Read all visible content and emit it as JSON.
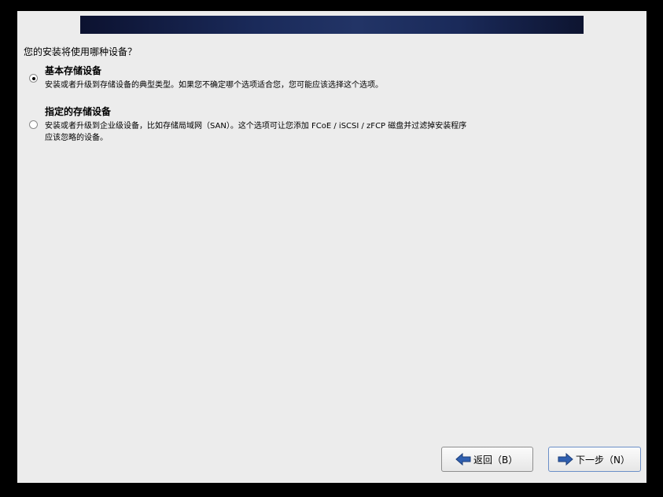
{
  "installer": {
    "question": "您的安装将使用哪种设备？",
    "options": [
      {
        "title": "基本存储设备",
        "desc_lines": [
          "安装或者升级到存储设备的典型类型。如果您不确定哪个选项适合您，您可能应该选择这个选项。"
        ],
        "selected": true
      },
      {
        "title": "指定的存储设备",
        "desc_lines": [
          "安装或者升级到企业级设备，比如存储局域网（SAN）。这个选项可让您添加 FCoE / iSCSI / zFCP 磁盘并过滤掉安装程序",
          "应该忽略的设备。"
        ],
        "selected": false
      }
    ],
    "buttons": {
      "back": "返回（B）",
      "next": "下一步（N）"
    }
  },
  "colors": {
    "background": "#ececec",
    "banner": "#1a2a5a",
    "arrow_blue": "#2f5fb0"
  }
}
